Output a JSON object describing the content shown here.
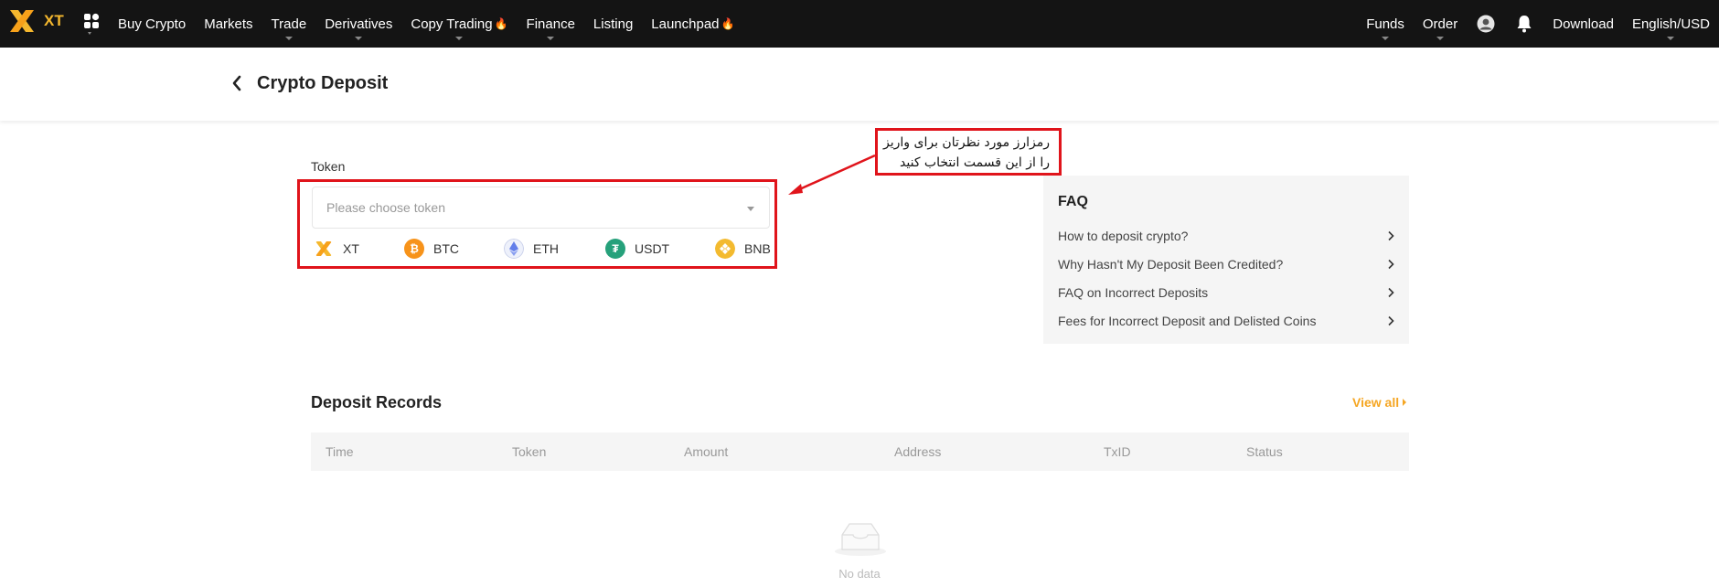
{
  "brand": {
    "name": "XT",
    "accent": "#f5b82e"
  },
  "nav": {
    "items": [
      {
        "label": "Buy Crypto",
        "caret": false,
        "fire": false
      },
      {
        "label": "Markets",
        "caret": false,
        "fire": false
      },
      {
        "label": "Trade",
        "caret": true,
        "fire": false
      },
      {
        "label": "Derivatives",
        "caret": true,
        "fire": false
      },
      {
        "label": "Copy Trading",
        "caret": true,
        "fire": true
      },
      {
        "label": "Finance",
        "caret": true,
        "fire": false
      },
      {
        "label": "Listing",
        "caret": false,
        "fire": false
      },
      {
        "label": "Launchpad",
        "caret": false,
        "fire": true
      }
    ],
    "right": {
      "funds": "Funds",
      "order": "Order",
      "download": "Download",
      "locale": "English/USD"
    }
  },
  "header": {
    "title": "Crypto Deposit"
  },
  "token": {
    "label": "Token",
    "placeholder": "Please choose token",
    "quick": [
      {
        "symbol": "XT",
        "icon": "xt-icon",
        "color": "#f5b82e"
      },
      {
        "symbol": "BTC",
        "icon": "btc-icon",
        "color": "#f7931a"
      },
      {
        "symbol": "ETH",
        "icon": "eth-icon",
        "color": "#627eea"
      },
      {
        "symbol": "USDT",
        "icon": "usdt-icon",
        "color": "#26a17b"
      },
      {
        "symbol": "BNB",
        "icon": "bnb-icon",
        "color": "#f3ba2f"
      }
    ]
  },
  "annotation": {
    "line1": "رمزارز مورد نظرتان برای واریز",
    "line2": "را از این قسمت انتخاب کنید",
    "color": "#e0141b"
  },
  "faq": {
    "title": "FAQ",
    "items": [
      "How to deposit crypto?",
      "Why Hasn't My Deposit Been Credited?",
      "FAQ on Incorrect Deposits",
      "Fees for Incorrect Deposit and Delisted Coins"
    ]
  },
  "records": {
    "title": "Deposit Records",
    "view_all": "View all",
    "columns": [
      "Time",
      "Token",
      "Amount",
      "Address",
      "TxID",
      "Status"
    ],
    "empty": "No data"
  }
}
